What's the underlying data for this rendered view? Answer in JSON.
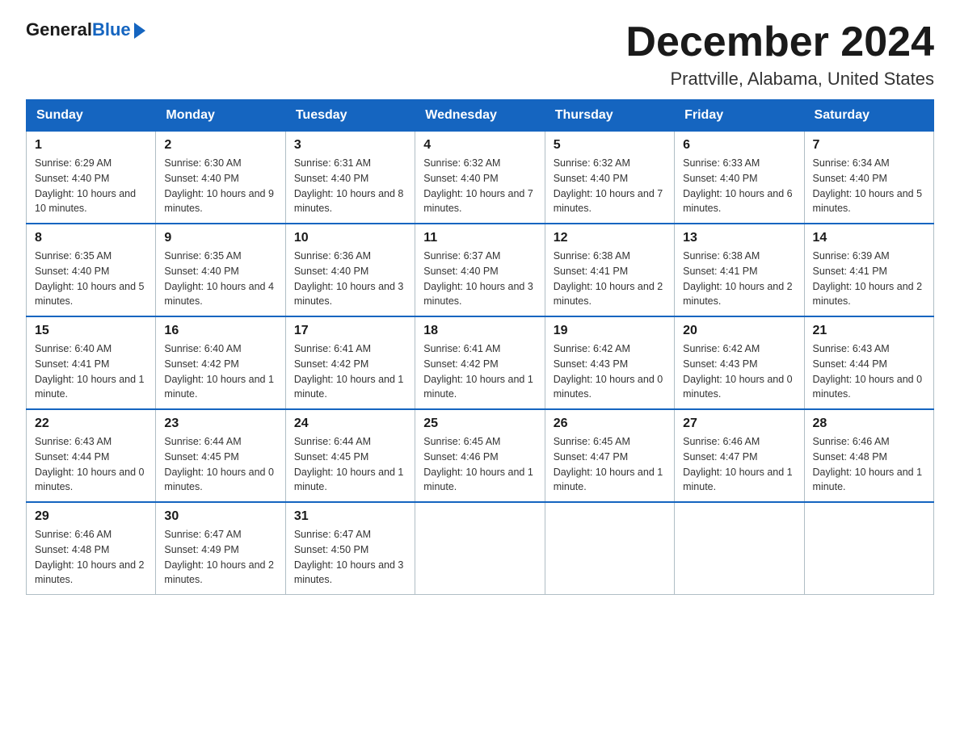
{
  "logo": {
    "general": "General",
    "blue": "Blue"
  },
  "title": "December 2024",
  "location": "Prattville, Alabama, United States",
  "weekdays": [
    "Sunday",
    "Monday",
    "Tuesday",
    "Wednesday",
    "Thursday",
    "Friday",
    "Saturday"
  ],
  "weeks": [
    [
      {
        "day": "1",
        "sunrise": "6:29 AM",
        "sunset": "4:40 PM",
        "daylight": "10 hours and 10 minutes."
      },
      {
        "day": "2",
        "sunrise": "6:30 AM",
        "sunset": "4:40 PM",
        "daylight": "10 hours and 9 minutes."
      },
      {
        "day": "3",
        "sunrise": "6:31 AM",
        "sunset": "4:40 PM",
        "daylight": "10 hours and 8 minutes."
      },
      {
        "day": "4",
        "sunrise": "6:32 AM",
        "sunset": "4:40 PM",
        "daylight": "10 hours and 7 minutes."
      },
      {
        "day": "5",
        "sunrise": "6:32 AM",
        "sunset": "4:40 PM",
        "daylight": "10 hours and 7 minutes."
      },
      {
        "day": "6",
        "sunrise": "6:33 AM",
        "sunset": "4:40 PM",
        "daylight": "10 hours and 6 minutes."
      },
      {
        "day": "7",
        "sunrise": "6:34 AM",
        "sunset": "4:40 PM",
        "daylight": "10 hours and 5 minutes."
      }
    ],
    [
      {
        "day": "8",
        "sunrise": "6:35 AM",
        "sunset": "4:40 PM",
        "daylight": "10 hours and 5 minutes."
      },
      {
        "day": "9",
        "sunrise": "6:35 AM",
        "sunset": "4:40 PM",
        "daylight": "10 hours and 4 minutes."
      },
      {
        "day": "10",
        "sunrise": "6:36 AM",
        "sunset": "4:40 PM",
        "daylight": "10 hours and 3 minutes."
      },
      {
        "day": "11",
        "sunrise": "6:37 AM",
        "sunset": "4:40 PM",
        "daylight": "10 hours and 3 minutes."
      },
      {
        "day": "12",
        "sunrise": "6:38 AM",
        "sunset": "4:41 PM",
        "daylight": "10 hours and 2 minutes."
      },
      {
        "day": "13",
        "sunrise": "6:38 AM",
        "sunset": "4:41 PM",
        "daylight": "10 hours and 2 minutes."
      },
      {
        "day": "14",
        "sunrise": "6:39 AM",
        "sunset": "4:41 PM",
        "daylight": "10 hours and 2 minutes."
      }
    ],
    [
      {
        "day": "15",
        "sunrise": "6:40 AM",
        "sunset": "4:41 PM",
        "daylight": "10 hours and 1 minute."
      },
      {
        "day": "16",
        "sunrise": "6:40 AM",
        "sunset": "4:42 PM",
        "daylight": "10 hours and 1 minute."
      },
      {
        "day": "17",
        "sunrise": "6:41 AM",
        "sunset": "4:42 PM",
        "daylight": "10 hours and 1 minute."
      },
      {
        "day": "18",
        "sunrise": "6:41 AM",
        "sunset": "4:42 PM",
        "daylight": "10 hours and 1 minute."
      },
      {
        "day": "19",
        "sunrise": "6:42 AM",
        "sunset": "4:43 PM",
        "daylight": "10 hours and 0 minutes."
      },
      {
        "day": "20",
        "sunrise": "6:42 AM",
        "sunset": "4:43 PM",
        "daylight": "10 hours and 0 minutes."
      },
      {
        "day": "21",
        "sunrise": "6:43 AM",
        "sunset": "4:44 PM",
        "daylight": "10 hours and 0 minutes."
      }
    ],
    [
      {
        "day": "22",
        "sunrise": "6:43 AM",
        "sunset": "4:44 PM",
        "daylight": "10 hours and 0 minutes."
      },
      {
        "day": "23",
        "sunrise": "6:44 AM",
        "sunset": "4:45 PM",
        "daylight": "10 hours and 0 minutes."
      },
      {
        "day": "24",
        "sunrise": "6:44 AM",
        "sunset": "4:45 PM",
        "daylight": "10 hours and 1 minute."
      },
      {
        "day": "25",
        "sunrise": "6:45 AM",
        "sunset": "4:46 PM",
        "daylight": "10 hours and 1 minute."
      },
      {
        "day": "26",
        "sunrise": "6:45 AM",
        "sunset": "4:47 PM",
        "daylight": "10 hours and 1 minute."
      },
      {
        "day": "27",
        "sunrise": "6:46 AM",
        "sunset": "4:47 PM",
        "daylight": "10 hours and 1 minute."
      },
      {
        "day": "28",
        "sunrise": "6:46 AM",
        "sunset": "4:48 PM",
        "daylight": "10 hours and 1 minute."
      }
    ],
    [
      {
        "day": "29",
        "sunrise": "6:46 AM",
        "sunset": "4:48 PM",
        "daylight": "10 hours and 2 minutes."
      },
      {
        "day": "30",
        "sunrise": "6:47 AM",
        "sunset": "4:49 PM",
        "daylight": "10 hours and 2 minutes."
      },
      {
        "day": "31",
        "sunrise": "6:47 AM",
        "sunset": "4:50 PM",
        "daylight": "10 hours and 3 minutes."
      },
      null,
      null,
      null,
      null
    ]
  ]
}
